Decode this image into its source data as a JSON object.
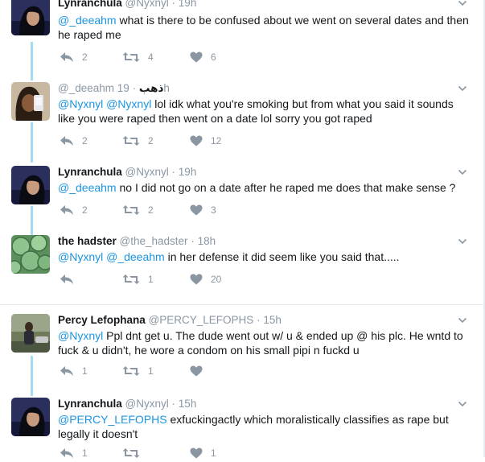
{
  "tweets": [
    {
      "name": "Lynranchula",
      "handle": "@Nyxnyl",
      "time": "19h",
      "mentions": "@_deeahm",
      "text": " what is there to be confused about we went on several dates and then he raped me",
      "reply": "2",
      "retweet": "4",
      "like": "6",
      "avatar": "avatar-lynranchula"
    },
    {
      "name": "",
      "handle": "@_deeahm",
      "handle_extra": "ذهب",
      "time": "19h",
      "mentions": "@Nyxnyl @Nyxnyl",
      "text": " lol idk what you're smoking but from what you said it sounds like you were raped then went on a date lol sorry you got raped",
      "reply": "2",
      "retweet": "2",
      "like": "12",
      "avatar": "avatar-deeahm"
    },
    {
      "name": "Lynranchula",
      "handle": "@Nyxnyl",
      "time": "19h",
      "mentions": "@_deeahm",
      "text": " no I did not go on a date after he raped me does that make sense ?",
      "reply": "2",
      "retweet": "2",
      "like": "3",
      "avatar": "avatar-lynranchula"
    },
    {
      "name": "the hadster",
      "handle": "@the_hadster",
      "time": "18h",
      "mentions": "@Nyxnyl @_deeahm",
      "text": " in her defense it did seem like you said that.....",
      "reply": "",
      "retweet": "1",
      "like": "20",
      "avatar": "avatar-hadster"
    },
    {
      "name": "Percy Lefophana",
      "handle": "@PERCY_LEFOPHS",
      "time": "15h",
      "mentions": "@Nyxnyl",
      "text": " Ppl dnt get u. The dude went out w/ u & ended up @ his plc. He wntd to fuck & u didn't, he wore a condom on his small pipi n fuckd u",
      "reply": "1",
      "retweet": "1",
      "like": "",
      "avatar": "avatar-percy"
    },
    {
      "name": "Lynranchula",
      "handle": "@Nyxnyl",
      "time": "15h",
      "mentions": "@PERCY_LEFOPHS",
      "text": " exfuckingactly which moralistically classifies as rape but legally it doesn't",
      "reply": "1",
      "retweet": "",
      "like": "1",
      "avatar": "avatar-lynranchula"
    }
  ],
  "dot": "·",
  "colors": {
    "link": "#1b95e0",
    "meta": "#8a97a3",
    "thread": "#a3d9f5"
  }
}
